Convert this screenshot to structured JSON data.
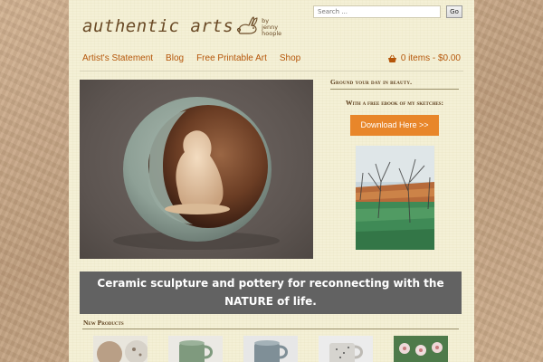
{
  "header": {
    "logo_text": "authentic arts",
    "logo_byline": "by jenny hoople",
    "search_placeholder": "Search ...",
    "search_button": "Go"
  },
  "nav": {
    "items": [
      {
        "label": "Artist's Statement"
      },
      {
        "label": "Blog"
      },
      {
        "label": "Free Printable Art"
      },
      {
        "label": "Shop"
      }
    ],
    "cart_label": "0 items - $0.00",
    "cart_icon": "basket-icon"
  },
  "sidebar": {
    "heading": "Ground your day in beauty.",
    "subheading": "With a free ebook of my sketches:",
    "button_label": "Download Here >>"
  },
  "hero": {
    "tagline_line1": "Ceramic sculpture and pottery for reconnecting with the",
    "tagline_line2": "NATURE of life."
  },
  "new_products": {
    "heading": "New Products"
  },
  "colors": {
    "link": "#b5560a",
    "button": "#e8862a",
    "tagline_bg": "#626262",
    "page_bg": "#f4f0d6"
  }
}
